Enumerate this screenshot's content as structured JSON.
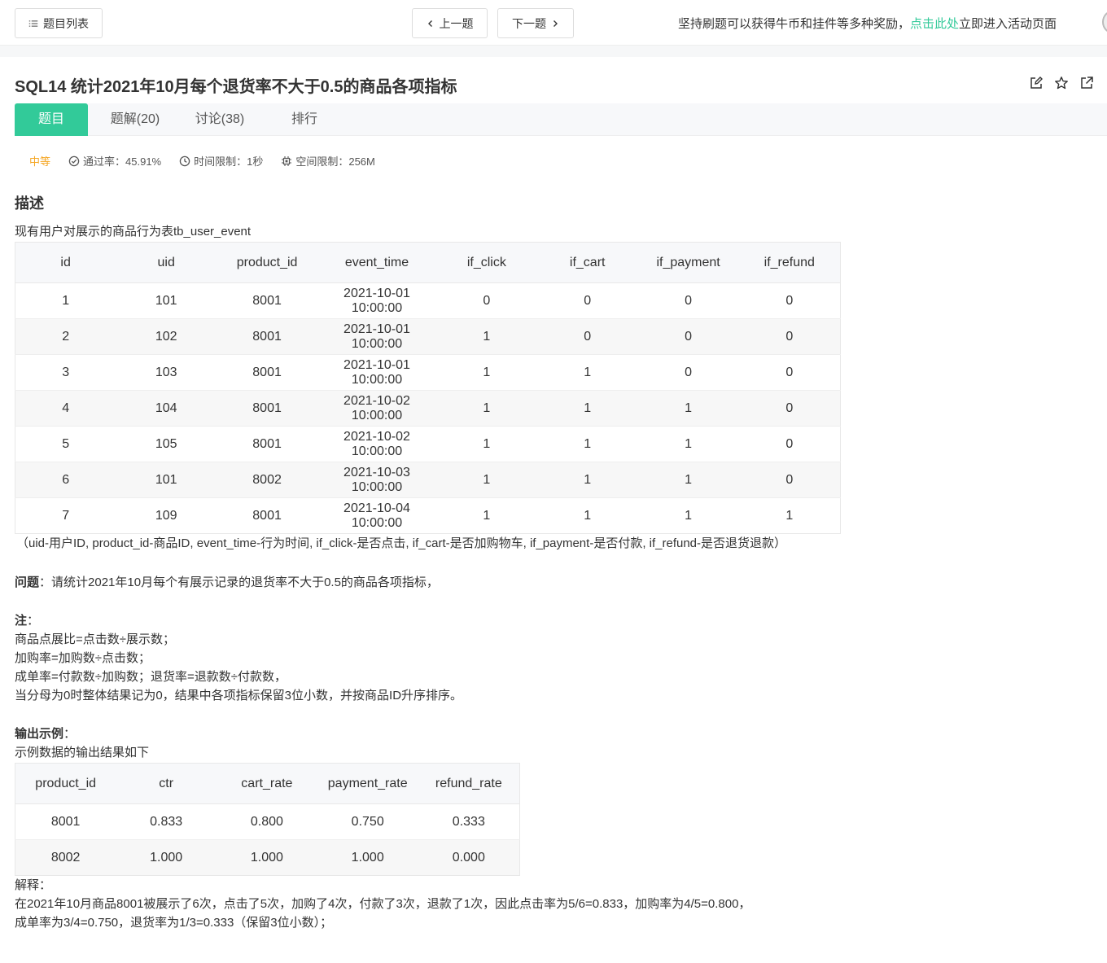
{
  "topbar": {
    "list_label": "题目列表",
    "prev_label": "上一题",
    "next_label": "下一题",
    "promo_before": "坚持刷题可以获得牛币和挂件等多种奖励，",
    "promo_link": "点击此处",
    "promo_after": "立即进入活动页面"
  },
  "problem": {
    "title": "SQL14  统计2021年10月每个退货率不大于0.5的商品各项指标"
  },
  "tabs": [
    {
      "label": "题目"
    },
    {
      "label": "题解(20)"
    },
    {
      "label": "讨论(38)"
    },
    {
      "label": "排行"
    }
  ],
  "meta": {
    "level": "中等",
    "pass_rate": "通过率：45.91%",
    "time_limit": "时间限制：1秒",
    "space_limit": "空间限制：256M"
  },
  "description": {
    "heading": "描述",
    "intro": "现有用户对展示的商品行为表tb_user_event",
    "table": {
      "headers": [
        "id",
        "uid",
        "product_id",
        "event_time",
        "if_click",
        "if_cart",
        "if_payment",
        "if_refund"
      ],
      "rows": [
        [
          "1",
          "101",
          "8001",
          "2021-10-01 10:00:00",
          "0",
          "0",
          "0",
          "0"
        ],
        [
          "2",
          "102",
          "8001",
          "2021-10-01 10:00:00",
          "1",
          "0",
          "0",
          "0"
        ],
        [
          "3",
          "103",
          "8001",
          "2021-10-01 10:00:00",
          "1",
          "1",
          "0",
          "0"
        ],
        [
          "4",
          "104",
          "8001",
          "2021-10-02 10:00:00",
          "1",
          "1",
          "1",
          "0"
        ],
        [
          "5",
          "105",
          "8001",
          "2021-10-02 10:00:00",
          "1",
          "1",
          "1",
          "0"
        ],
        [
          "6",
          "101",
          "8002",
          "2021-10-03 10:00:00",
          "1",
          "1",
          "1",
          "0"
        ],
        [
          "7",
          "109",
          "8001",
          "2021-10-04 10:00:00",
          "1",
          "1",
          "1",
          "1"
        ]
      ]
    },
    "legend": "（uid-用户ID, product_id-商品ID, event_time-行为时间, if_click-是否点击, if_cart-是否加购物车, if_payment-是否付款, if_refund-是否退货退款）",
    "question_label": "问题",
    "question_text": "：请统计2021年10月每个有展示记录的退货率不大于0.5的商品各项指标，",
    "note_label": "注",
    "note_colon": "：",
    "notes": [
      "商品点展比=点击数÷展示数；",
      "加购率=加购数÷点击数；",
      "成单率=付款数÷加购数；退货率=退款数÷付款数，",
      "当分母为0时整体结果记为0，结果中各项指标保留3位小数，并按商品ID升序排序。"
    ],
    "output_label": "输出示例",
    "output_colon": "：",
    "output_intro": "示例数据的输出结果如下",
    "output_table": {
      "headers": [
        "product_id",
        "ctr",
        "cart_rate",
        "payment_rate",
        "refund_rate"
      ],
      "rows": [
        [
          "8001",
          "0.833",
          "0.800",
          "0.750",
          "0.333"
        ],
        [
          "8002",
          "1.000",
          "1.000",
          "1.000",
          "0.000"
        ]
      ]
    },
    "explain_label": "解释：",
    "explain_lines": [
      "在2021年10月商品8001被展示了6次，点击了5次，加购了4次，付款了3次，退款了1次，因此点击率为5/6=0.833，加购率为4/5=0.800，",
      "成单率为3/4=0.750，退货率为1/3=0.333（保留3位小数）；"
    ]
  },
  "colors": {
    "accent": "#32ca99",
    "level": "#f5a623"
  }
}
